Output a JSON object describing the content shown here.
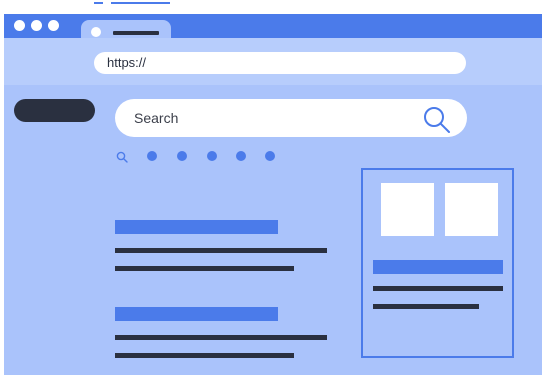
{
  "browser": {
    "window_controls": [
      "close",
      "minimize",
      "maximize"
    ],
    "address_bar": {
      "url": "https://"
    }
  },
  "search": {
    "placeholder": "Search"
  },
  "search_tabs": {
    "count": 5
  },
  "results": [
    {
      "id": 1
    },
    {
      "id": 2
    }
  ],
  "colors": {
    "accent": "#4b7bea",
    "page_bg": "#aac3fb",
    "dark": "#2a3040",
    "white": "#ffffff"
  }
}
